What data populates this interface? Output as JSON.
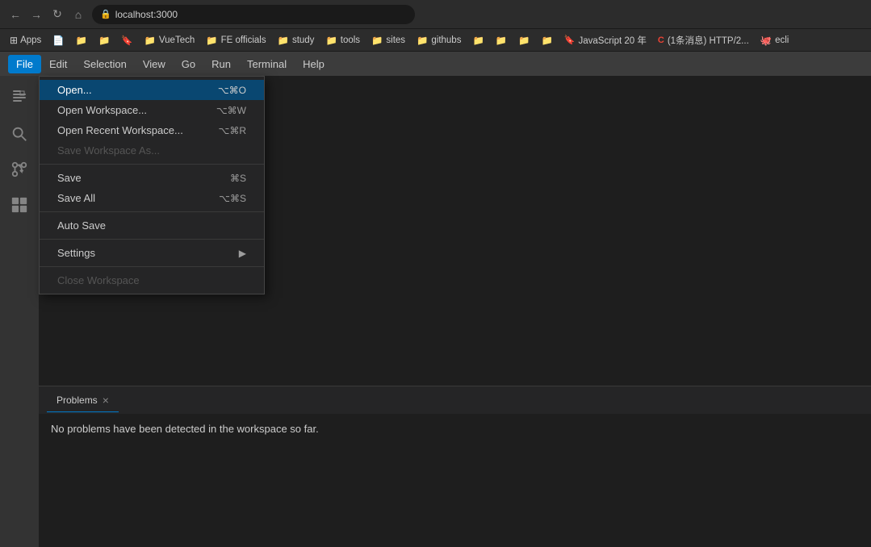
{
  "browser": {
    "address": "localhost:3000",
    "nav": {
      "back": "←",
      "forward": "→",
      "refresh": "↻",
      "home": "⌂"
    }
  },
  "bookmarks": {
    "apps_label": "Apps",
    "items": [
      {
        "label": "",
        "icon": "📄",
        "type": "folder"
      },
      {
        "label": "",
        "icon": "📁",
        "type": "folder"
      },
      {
        "label": "",
        "icon": "📁",
        "type": "folder"
      },
      {
        "label": "",
        "icon": "🔖",
        "type": "folder"
      },
      {
        "label": "VueTech",
        "icon": "📁",
        "type": "folder"
      },
      {
        "label": "FE officials",
        "icon": "📁",
        "type": "folder"
      },
      {
        "label": "study",
        "icon": "📁",
        "type": "folder"
      },
      {
        "label": "tools",
        "icon": "📁",
        "type": "folder"
      },
      {
        "label": "sites",
        "icon": "📁",
        "type": "folder"
      },
      {
        "label": "githubs",
        "icon": "📁",
        "type": "folder"
      },
      {
        "label": "",
        "icon": "📁",
        "type": "folder"
      },
      {
        "label": "",
        "icon": "📁",
        "type": "folder"
      },
      {
        "label": "",
        "icon": "📁",
        "type": "folder"
      },
      {
        "label": "",
        "icon": "📁",
        "type": "folder"
      },
      {
        "label": "JavaScript 20 年",
        "icon": "🔖",
        "type": "link"
      },
      {
        "label": "(1条消息) HTTP/2...",
        "icon": "C",
        "type": "link"
      },
      {
        "label": "ecli",
        "icon": "🐙",
        "type": "link"
      }
    ]
  },
  "menubar": {
    "items": [
      "File",
      "Edit",
      "Selection",
      "View",
      "Go",
      "Run",
      "Terminal",
      "Help"
    ]
  },
  "file_menu": {
    "title": "File",
    "items": [
      {
        "label": "Open...",
        "shortcut": "⌥⌘O",
        "state": "highlighted",
        "has_arrow": false
      },
      {
        "label": "Open Workspace...",
        "shortcut": "⌥⌘W",
        "state": "normal",
        "has_arrow": false
      },
      {
        "label": "Open Recent Workspace...",
        "shortcut": "⌥⌘R",
        "state": "normal",
        "has_arrow": false
      },
      {
        "label": "Save Workspace As...",
        "shortcut": "",
        "state": "disabled",
        "has_arrow": false
      },
      {
        "separator": true
      },
      {
        "label": "Save",
        "shortcut": "⌘S",
        "state": "normal",
        "has_arrow": false
      },
      {
        "label": "Save All",
        "shortcut": "⌥⌘S",
        "state": "normal",
        "has_arrow": false
      },
      {
        "separator": true
      },
      {
        "label": "Auto Save",
        "shortcut": "",
        "state": "normal",
        "has_arrow": false
      },
      {
        "separator": true
      },
      {
        "label": "Settings",
        "shortcut": "",
        "state": "normal",
        "has_arrow": true
      },
      {
        "separator": true
      },
      {
        "label": "Close Workspace",
        "shortcut": "",
        "state": "disabled",
        "has_arrow": false
      }
    ]
  },
  "activity_bar": {
    "icons": [
      {
        "name": "files",
        "symbol": "⧉",
        "active": false
      },
      {
        "name": "search",
        "symbol": "🔍",
        "active": false
      },
      {
        "name": "source-control",
        "symbol": "⎇",
        "active": false
      },
      {
        "name": "extensions",
        "symbol": "⊞",
        "active": false
      }
    ]
  },
  "bottom_panel": {
    "tab_label": "Problems",
    "close_symbol": "×",
    "content": "No problems have been detected in the workspace so far."
  }
}
